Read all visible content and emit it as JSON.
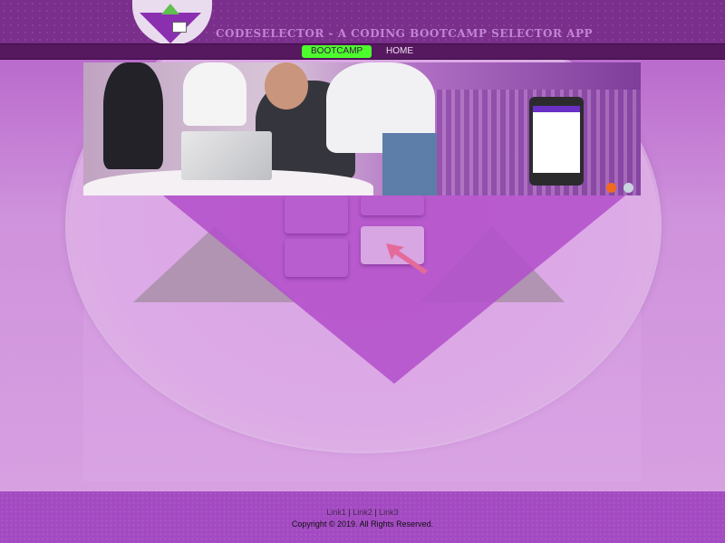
{
  "header": {
    "site_title": "CODESELECTOR - A CODING BOOTCAMP SELECTOR APP"
  },
  "nav": {
    "items": [
      {
        "label": "BOOTCAMP",
        "active": true
      },
      {
        "label": "HOME",
        "active": false
      }
    ],
    "active_color": "#4cff2c"
  },
  "hero": {
    "carousel_dots": [
      "active",
      "inactive"
    ]
  },
  "footer": {
    "links": [
      "Link1",
      "Link2",
      "Link3"
    ],
    "separator": "|",
    "copyright": "Copyright © 2019. All Rights Reserved."
  },
  "colors": {
    "brand_purple": "#7a2f8c",
    "nav_bg": "#56185f",
    "footer_bg": "#a34ac2"
  }
}
